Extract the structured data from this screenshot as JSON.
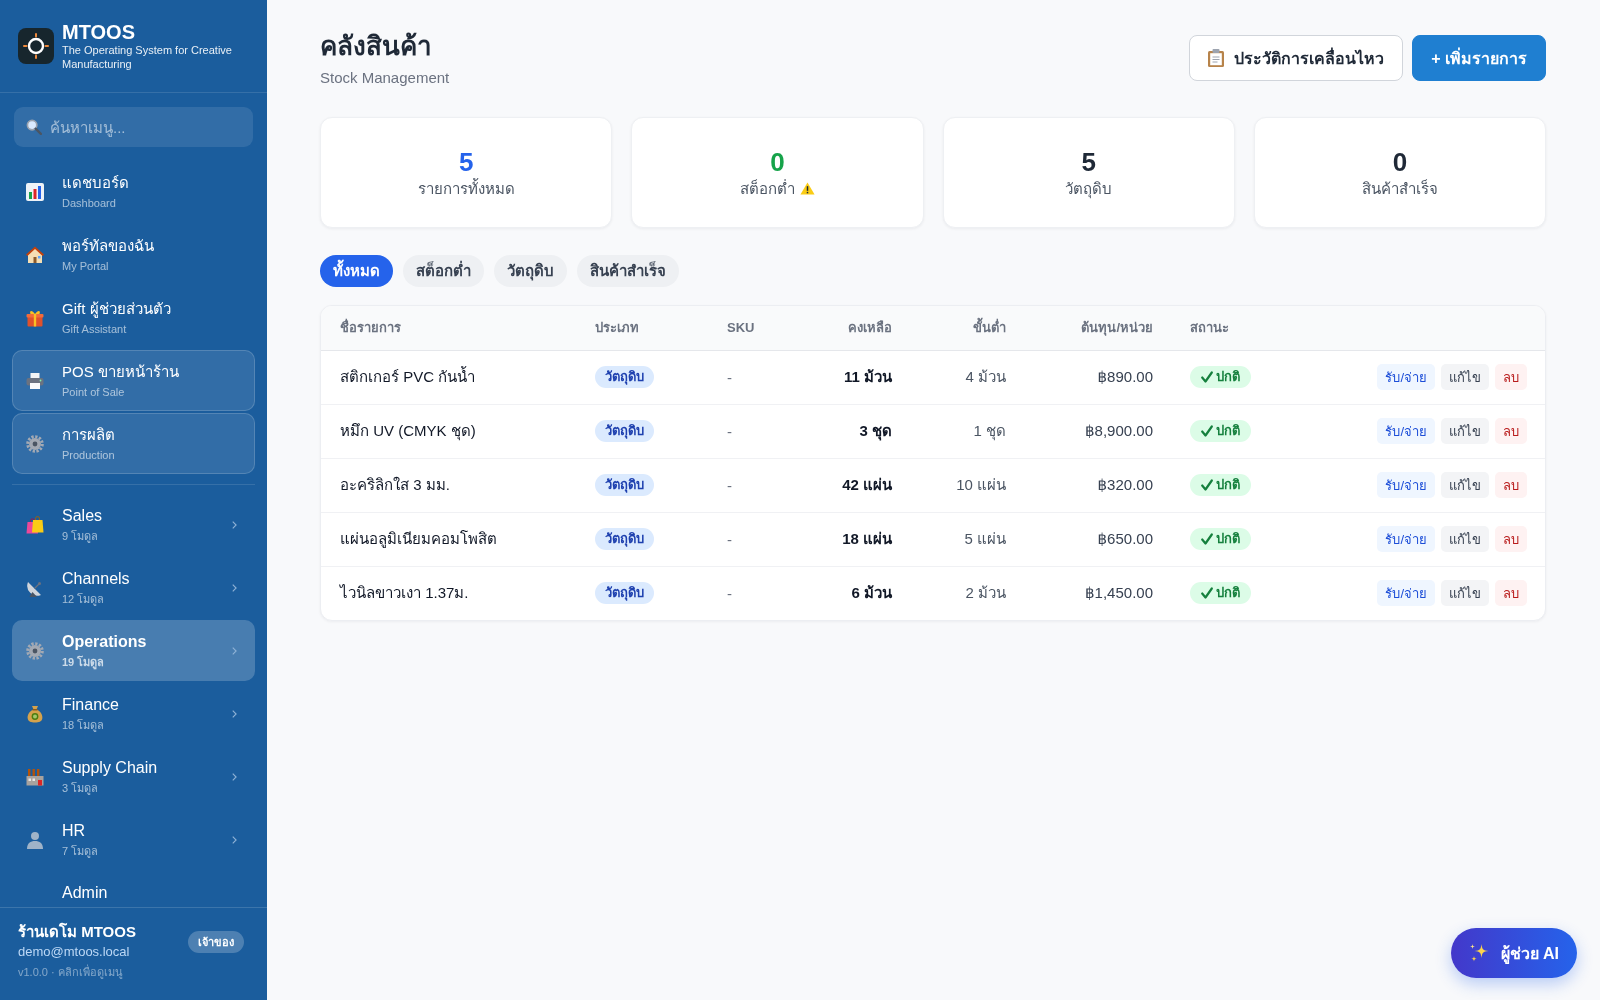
{
  "sidebar": {
    "brand": {
      "name": "MTOOS",
      "tagline": "The Operating System for Creative Manufacturing"
    },
    "search": {
      "placeholder": "ค้นหาเมนู..."
    },
    "pinned_items": [
      {
        "label": "แดชบอร์ด",
        "sublabel": "Dashboard",
        "highlighted": false
      },
      {
        "label": "พอร์ทัลของฉัน",
        "sublabel": "My Portal",
        "highlighted": false
      },
      {
        "label": "Gift ผู้ช่วยส่วนตัว",
        "sublabel": "Gift Assistant",
        "highlighted": false
      },
      {
        "label": "POS ขายหน้าร้าน",
        "sublabel": "Point of Sale",
        "highlighted": true
      },
      {
        "label": "การผลิต",
        "sublabel": "Production",
        "highlighted": true
      }
    ],
    "groups": [
      {
        "label": "Sales",
        "sublabel": "9 โมดูล",
        "selected": false
      },
      {
        "label": "Channels",
        "sublabel": "12 โมดูล",
        "selected": false
      },
      {
        "label": "Operations",
        "sublabel": "19 โมดูล",
        "selected": true
      },
      {
        "label": "Finance",
        "sublabel": "18 โมดูล",
        "selected": false
      },
      {
        "label": "Supply Chain",
        "sublabel": "3 โมดูล",
        "selected": false
      },
      {
        "label": "HR",
        "sublabel": "7 โมดูล",
        "selected": false
      },
      {
        "label": "Admin",
        "selected": false
      }
    ],
    "user": {
      "name": "ร้านเดโม MTOOS",
      "email": "demo@mtoos.local",
      "role": "เจ้าของ",
      "footnote": "v1.0.0 · คลิกเพื่อดูเมนู"
    }
  },
  "page": {
    "title": "คลังสินค้า",
    "subtitle": "Stock Management",
    "actions": [
      {
        "label": "ประวัติการเคลื่อนไหว",
        "kind": "secondary"
      },
      {
        "label": "+ เพิ่มรายการ",
        "kind": "primary"
      }
    ]
  },
  "stats": [
    {
      "value": "5",
      "label": "รายการทั้งหมด",
      "color": "#2563eb",
      "warning": false
    },
    {
      "value": "0",
      "label": "สต็อกต่ำ",
      "color": "#16a34a",
      "warning": true
    },
    {
      "value": "5",
      "label": "วัตถุดิบ",
      "color": "#1f2937",
      "warning": false
    },
    {
      "value": "0",
      "label": "สินค้าสำเร็จ",
      "color": "#1f2937",
      "warning": false
    }
  ],
  "filters": [
    {
      "label": "ทั้งหมด",
      "selected": true
    },
    {
      "label": "สต็อกต่ำ",
      "selected": false
    },
    {
      "label": "วัตถุดิบ",
      "selected": false
    },
    {
      "label": "สินค้าสำเร็จ",
      "selected": false
    }
  ],
  "table": {
    "columns": [
      "ชื่อรายการ",
      "ประเภท",
      "SKU",
      "คงเหลือ",
      "ขั้นต่ำ",
      "ต้นทุน/หน่วย",
      "สถานะ"
    ],
    "rows": [
      {
        "name": "สติกเกอร์ PVC กันน้ำ",
        "type": "วัตถุดิบ",
        "sku": "-",
        "remaining": "11 ม้วน",
        "minimum": "4 ม้วน",
        "unit_cost": "฿890.00",
        "status": {
          "label": "ปกติ",
          "kind": "ok"
        },
        "actions": [
          {
            "label": "รับ/จ่าย",
            "kind": "move"
          },
          {
            "label": "แก้ไข",
            "kind": "edit"
          },
          {
            "label": "ลบ",
            "kind": "delete"
          }
        ]
      },
      {
        "name": "หมึก UV (CMYK ชุด)",
        "type": "วัตถุดิบ",
        "sku": "-",
        "remaining": "3 ชุด",
        "minimum": "1 ชุด",
        "unit_cost": "฿8,900.00",
        "status": {
          "label": "ปกติ",
          "kind": "ok"
        },
        "actions": [
          {
            "label": "รับ/จ่าย",
            "kind": "move"
          },
          {
            "label": "แก้ไข",
            "kind": "edit"
          },
          {
            "label": "ลบ",
            "kind": "delete"
          }
        ]
      },
      {
        "name": "อะคริลิกใส 3 มม.",
        "type": "วัตถุดิบ",
        "sku": "-",
        "remaining": "42 แผ่น",
        "minimum": "10 แผ่น",
        "unit_cost": "฿320.00",
        "status": {
          "label": "ปกติ",
          "kind": "ok"
        },
        "actions": [
          {
            "label": "รับ/จ่าย",
            "kind": "move"
          },
          {
            "label": "แก้ไข",
            "kind": "edit"
          },
          {
            "label": "ลบ",
            "kind": "delete"
          }
        ]
      },
      {
        "name": "แผ่นอลูมิเนียมคอมโพสิต",
        "type": "วัตถุดิบ",
        "sku": "-",
        "remaining": "18 แผ่น",
        "minimum": "5 แผ่น",
        "unit_cost": "฿650.00",
        "status": {
          "label": "ปกติ",
          "kind": "ok"
        },
        "actions": [
          {
            "label": "รับ/จ่าย",
            "kind": "move"
          },
          {
            "label": "แก้ไข",
            "kind": "edit"
          },
          {
            "label": "ลบ",
            "kind": "delete"
          }
        ]
      },
      {
        "name": "ไวนิลขาวเงา 1.37ม.",
        "type": "วัตถุดิบ",
        "sku": "-",
        "remaining": "6 ม้วน",
        "minimum": "2 ม้วน",
        "unit_cost": "฿1,450.00",
        "status": {
          "label": "ปกติ",
          "kind": "ok"
        },
        "actions": [
          {
            "label": "รับ/จ่าย",
            "kind": "move"
          },
          {
            "label": "แก้ไข",
            "kind": "edit"
          },
          {
            "label": "ลบ",
            "kind": "delete"
          }
        ]
      }
    ]
  },
  "assistant_button": {
    "label": "ผู้ช่วย AI"
  }
}
